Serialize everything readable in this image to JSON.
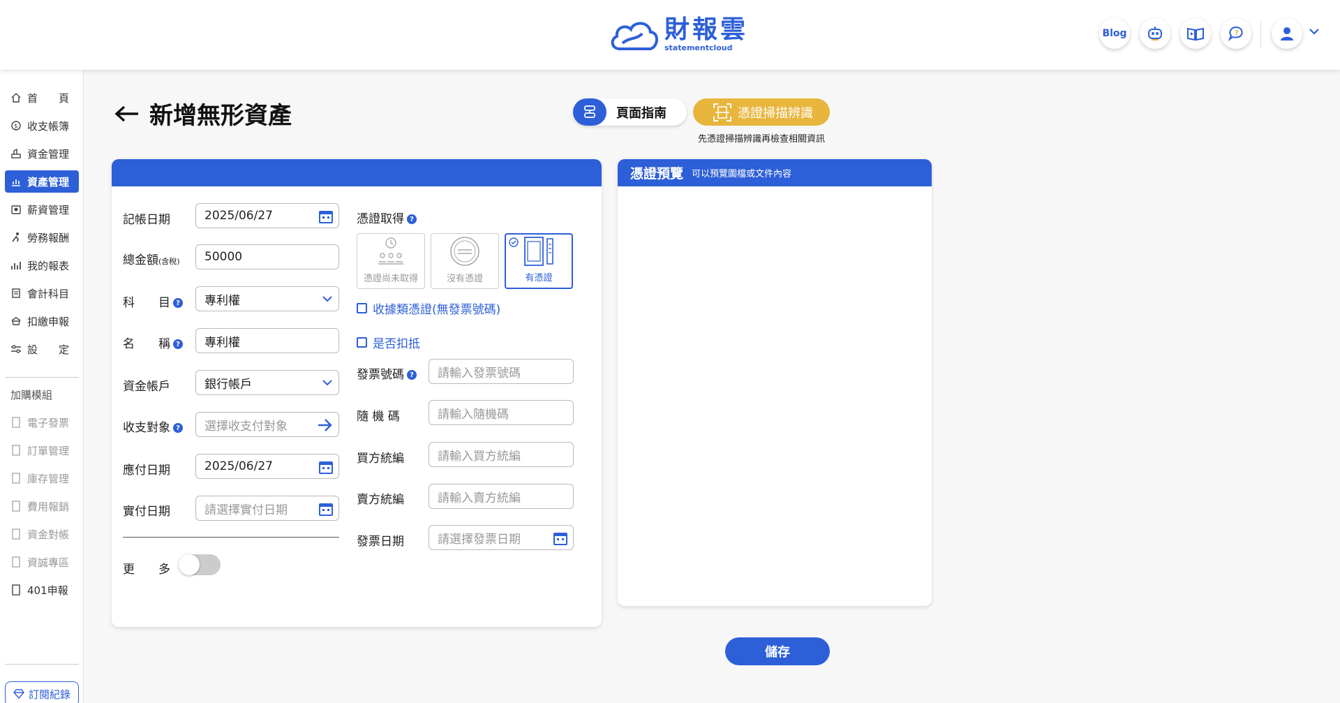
{
  "app": {
    "logo_cn": "財報雲",
    "logo_en": "statementcloud",
    "blog_label": "Blog"
  },
  "sidebar": {
    "items": [
      {
        "label": "首　　頁",
        "icon": "home-icon"
      },
      {
        "label": "收支帳簿",
        "icon": "coin-icon"
      },
      {
        "label": "資金管理",
        "icon": "fund-icon"
      },
      {
        "label": "資產管理",
        "icon": "asset-icon",
        "active": true
      },
      {
        "label": "薪資管理",
        "icon": "salary-icon"
      },
      {
        "label": "勞務報酬",
        "icon": "labor-icon"
      },
      {
        "label": "我的報表",
        "icon": "chart-icon"
      },
      {
        "label": "會計科目",
        "icon": "ledger-icon"
      },
      {
        "label": "扣繳申報",
        "icon": "tax-icon"
      },
      {
        "label": "設　　定",
        "icon": "settings-icon"
      }
    ],
    "addon_title": "加購模組",
    "addons": [
      {
        "label": "電子發票"
      },
      {
        "label": "訂單管理"
      },
      {
        "label": "庫存管理"
      },
      {
        "label": "費用報銷"
      },
      {
        "label": "資金對帳"
      },
      {
        "label": "資誠專區"
      },
      {
        "label": "401申報"
      }
    ],
    "subscription_label": "訂閱紀錄"
  },
  "page": {
    "title": "新增無形資產",
    "guide_label": "頁面指南",
    "scan_label": "憑證掃描辨識",
    "scan_hint": "先憑證掃描辨識再檢查相關資訊"
  },
  "form": {
    "date_label": "記帳日期",
    "date_value": "2025/06/27",
    "amount_label": "總金額",
    "amount_suffix": "(含稅)",
    "amount_value": "50000",
    "subject_label": "科　　目",
    "subject_value": "專利權",
    "name_label": "名　　稱",
    "name_value": "專利權",
    "account_label": "資金帳戶",
    "account_value": "銀行帳戶",
    "party_label": "收支對象",
    "party_placeholder": "選擇收支付對象",
    "due_label": "應付日期",
    "due_value": "2025/06/27",
    "paid_label": "實付日期",
    "paid_placeholder": "請選擇實付日期",
    "more_label": "更　　多",
    "voucher_label": "憑證取得",
    "voucher_options": [
      {
        "label": "憑證尚未取得"
      },
      {
        "label": "沒有憑證"
      },
      {
        "label": "有憑證",
        "selected": true
      }
    ],
    "receipt_check_label": "收據類憑證(無發票號碼)",
    "deduct_check_label": "是否扣抵",
    "invoice_no_label": "發票號碼",
    "invoice_no_placeholder": "請輸入發票號碼",
    "random_label": "隨 機 碼",
    "random_placeholder": "請輸入隨機碼",
    "buyer_label": "買方統編",
    "buyer_placeholder": "請輸入買方統編",
    "seller_label": "賣方統編",
    "seller_placeholder": "請輸入賣方統編",
    "invoice_date_label": "發票日期",
    "invoice_date_placeholder": "請選擇發票日期"
  },
  "preview": {
    "title": "憑證預覽",
    "subtitle": "可以預覽圖檔或文件內容"
  },
  "actions": {
    "save_label": "儲存"
  },
  "colors": {
    "brand": "#2d5fd8",
    "scan": "#e8b53d"
  }
}
